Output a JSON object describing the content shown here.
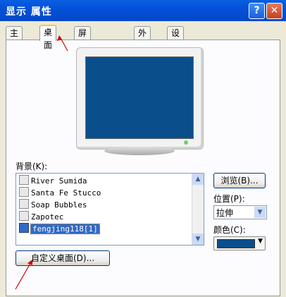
{
  "window": {
    "title": "显示 属性",
    "help": "?",
    "close": "✕"
  },
  "tabs": [
    {
      "label": "主题"
    },
    {
      "label": "桌面"
    },
    {
      "label": "屏幕保护程序"
    },
    {
      "label": "外观"
    },
    {
      "label": "设置"
    }
  ],
  "background": {
    "label": "背景(K):",
    "items": [
      "River Sumida",
      "Santa Fe Stucco",
      "Soap Bubbles",
      "Zapotec",
      "fengjing118[1]"
    ],
    "selected": "fengjing118[1]"
  },
  "buttons": {
    "browse": "浏览(B)...",
    "customize": "自定义桌面(D)..."
  },
  "position": {
    "label": "位置(P):",
    "value": "拉伸"
  },
  "color": {
    "label": "颜色(C):",
    "value": "#0b4e8c"
  },
  "colors": {
    "titlebar": "#0450d8",
    "selection": "#316ac5",
    "annotation": "#d40000"
  }
}
